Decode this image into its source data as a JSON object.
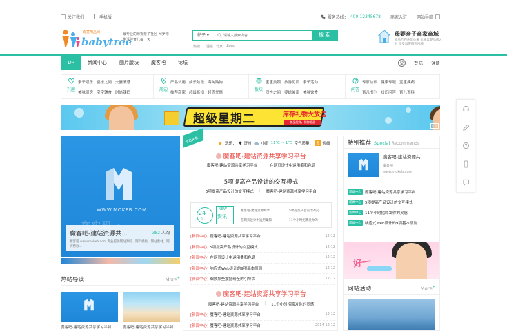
{
  "topbar": {
    "follow": "关注我们",
    "mobile": "手机版",
    "hotline_label": "服务热线：",
    "hotline": "400-12345678",
    "merchant": "商家入驻",
    "site_nav": "网站导航"
  },
  "header": {
    "logo_tag": "婴童用品网",
    "logo_text": "babytree",
    "slogan": "最专业的母婴亲子社区 网罗你生活伴育儿每一天",
    "search": {
      "select": "帖子",
      "placeholder": "请输入搜索内容",
      "button": "搜 索",
      "hot_label": "热搜：",
      "hot": [
        "温泉",
        "北京",
        "dioud"
      ]
    },
    "mall": {
      "title": "母婴亲子商家商城",
      "desc": "商品几百件等你来 优质母婴品牌入驻 享受母婴购物乐趣"
    }
  },
  "nav": {
    "items": [
      "DP",
      "新闻中心",
      "图片版块",
      "魔客吧",
      "论坛"
    ],
    "active_index": 0,
    "login": "登陆",
    "register": "注册"
  },
  "categories": [
    {
      "icon": "heart-icon",
      "label": "兴趣",
      "links": [
        "亲子娱乐",
        "婆媳之间",
        "夫妻情感",
        "美味厨房",
        "宝宝辅食",
        "时尚辣妈"
      ]
    },
    {
      "icon": "location-icon",
      "label": "周边",
      "links": [
        "产品试用",
        "成长阶段",
        "海淘购物",
        "推荐商家",
        "超级折扣",
        "超值优惠"
      ]
    },
    {
      "icon": "globe-icon",
      "label": "板块",
      "links": [
        "宝宝美照",
        "旅游见闻",
        "亲子活动",
        "同性之间",
        "婆媳关系",
        "美味饮食"
      ]
    },
    {
      "icon": "question-icon",
      "label": "问答",
      "links": [
        "专家访谈",
        "健康专题",
        "宝宝疾病",
        "育儿书刊",
        "知识问答",
        "育儿百科"
      ]
    }
  ],
  "banner": {
    "main_text": "超级星期二",
    "sub_text": "库存礼物大放送",
    "pill_text": "新品抢鲜，礼物相送",
    "ad_tag": "广告"
  },
  "slider": {
    "url": "WWW.MOKEB.COM",
    "ghost": "在实现 ·",
    "title": "魔客吧-建站资源共...",
    "count": "382",
    "count_unit": "人阅",
    "desc": "魔客吧 www.mokeb.com 专业提供网站源码、网页模板、网站素材，网页特效..."
  },
  "hotpost": {
    "title": "热帖导读",
    "more": "More",
    "items": [
      "魔客吧-建站资源共享学习平台",
      "魔客吧-建站资源共享学习平台"
    ]
  },
  "middle": {
    "ribbon": "今日头条",
    "weather": {
      "label": "玩乐：",
      "city": "济州",
      "cond": "小雨",
      "temp": "11℃ ~ 1℃",
      "aq_label": "空气质量：",
      "aq": "良",
      "aq_level": "优级"
    },
    "headline1": "魔客吧-建站资源共享学习平台",
    "sub1": [
      "魔客吧-建站资源共享学习平台",
      "在网页设计中运用柔和色调"
    ],
    "headline2": "5项提高产品设计的交互模式",
    "sub2": [
      "5项提高产品设计的交互模式",
      "魔客吧-建站资源共享学习平台"
    ],
    "promo": {
      "c24": "24",
      "chr": "hr",
      "new": "NEW",
      "zx": "资讯",
      "links": [
        "魔客吧-建站资源共享",
        "5项提高产品设计的交",
        "在网页设计中运用柔和",
        "11个小时招聘发你的"
      ]
    },
    "list1": [
      {
        "tag": "[新闻中心]",
        "text": "魔客吧-建站资源共享学习平台",
        "date": "12-12"
      },
      {
        "tag": "[新闻中心]",
        "text": "5项提高产品设计的交互模式",
        "date": "12-12"
      },
      {
        "tag": "[新闻中心]",
        "text": "在网页设计中运用柔和色调",
        "date": "12-12"
      },
      {
        "tag": "[新闻中心]",
        "text": "响应式Web设计的9项基本原则",
        "date": "12-12"
      },
      {
        "tag": "[新闻中心]",
        "text": "细数那些震撼纷至的引导页",
        "date": "12-12"
      }
    ],
    "headline3": "魔客吧-建站资源共享学习平台",
    "sub3": [
      "魔客吧-建站资源共享学习平台",
      "11个小时招聘发你的灵感"
    ],
    "list2": [
      {
        "tag": "[新闻中心]",
        "text": "魔客吧-建站资源共享学习平台",
        "date": "12-12"
      },
      {
        "tag": "[新闻中心]",
        "text": "魔客吧-建站资源共享学习平台",
        "date": "2014-12-12"
      }
    ]
  },
  "right": {
    "title": "特别推荐",
    "title_en": "Special",
    "title_en2": "Recommends",
    "feature": {
      "title": "魔客吧-建站资源共",
      "author": "魔客吧",
      "url": "www.mokeb.com"
    },
    "list": [
      {
        "badge": "新闻中心",
        "text": "魔客吧-建站资源共享学习平台"
      },
      {
        "badge": "新闻中心",
        "text": "5项提高产品设计的交互模式"
      },
      {
        "badge": "新闻中心",
        "text": "11个小时招聘发你的灵感"
      },
      {
        "badge": "新闻中心",
        "text": "响应式Web设计的9项基本原则"
      }
    ],
    "ad_text": "好一",
    "activity_title": "网站活动",
    "activity_more": "More"
  },
  "colors": {
    "accent": "#2bbfa4",
    "red": "#e8413b",
    "blue": "#1f86d8"
  }
}
